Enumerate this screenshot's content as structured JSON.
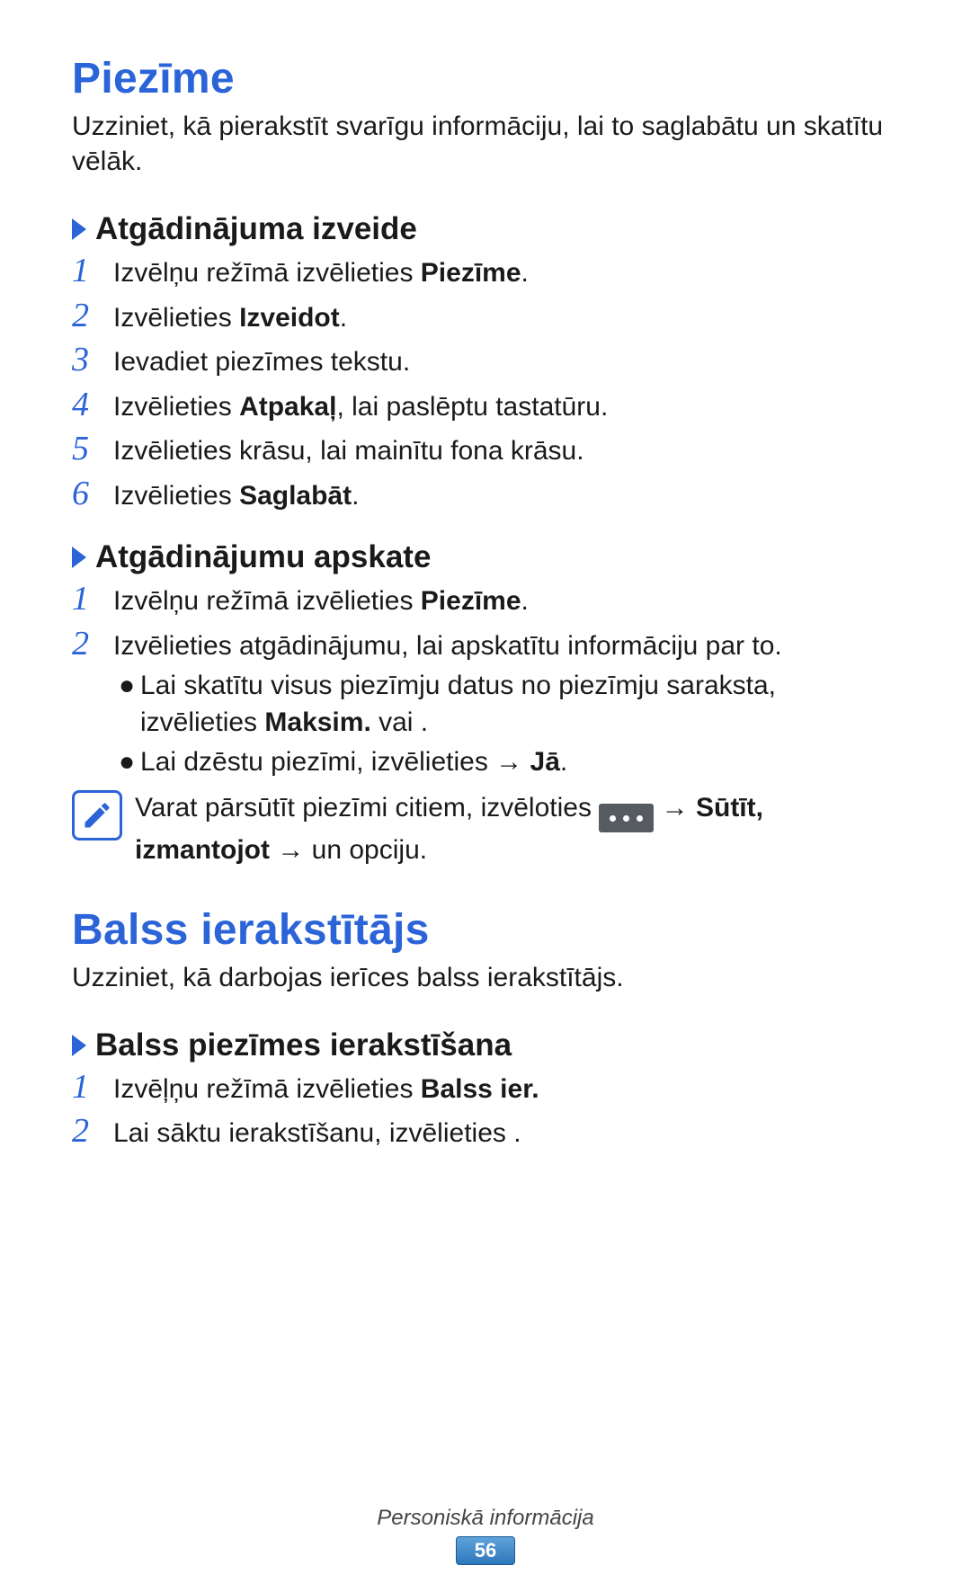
{
  "section1": {
    "title": "Piezīme",
    "intro": "Uzziniet, kā pierakstīt svarīgu informāciju, lai to saglabātu un skatītu vēlāk.",
    "sub1": {
      "title": "Atgādinājuma izveide",
      "steps": {
        "s1_pre": "Izvēlņu režīmā izvēlieties ",
        "s1_b": "Piezīme",
        "s1_post": ".",
        "s2_pre": "Izvēlieties ",
        "s2_b": "Izveidot",
        "s2_post": ".",
        "s3": "Ievadiet piezīmes tekstu.",
        "s4_pre": "Izvēlieties ",
        "s4_b": "Atpakaļ",
        "s4_post": ", lai paslēptu tastatūru.",
        "s5": "Izvēlieties krāsu, lai mainītu fona krāsu.",
        "s6_pre": "Izvēlieties ",
        "s6_b": "Saglabāt",
        "s6_post": "."
      }
    },
    "sub2": {
      "title": "Atgādinājumu apskate",
      "s1_pre": "Izvēlņu režīmā izvēlieties ",
      "s1_b": "Piezīme",
      "s1_post": ".",
      "s2": "Izvēlieties atgādinājumu, lai apskatītu informāciju par to.",
      "b1_pre": "Lai skatītu visus piezīmju datus no piezīmju saraksta, izvēlieties ",
      "b1_b": "Maksim.",
      "b1_post": " vai     .",
      "b2_pre": "Lai dzēstu piezīmi, izvēlieties      ",
      "b2_arrow": "→ ",
      "b2_b": "Jā",
      "b2_post": "."
    },
    "note": {
      "pre": "Varat pārsūtīt piezīmi citiem, izvēloties ",
      "arrow1": " → ",
      "b1": "Sūtīt, izmantojot",
      "arrow2": " → ",
      "post": "un opciju."
    }
  },
  "section2": {
    "title": "Balss ierakstītājs",
    "intro": "Uzziniet, kā darbojas ierīces balss ierakstītājs.",
    "sub1": {
      "title": "Balss piezīmes ierakstīšana",
      "s1_pre": "Izvēļņu režīmā izvēlieties ",
      "s1_b": "Balss ier.",
      "s2": "Lai sāktu ierakstīšanu, izvēlieties     ."
    }
  },
  "footer": {
    "category": "Personiskā informācija",
    "page": "56"
  },
  "nums": {
    "n1": "1",
    "n2": "2",
    "n3": "3",
    "n4": "4",
    "n5": "5",
    "n6": "6"
  },
  "dot": "●"
}
